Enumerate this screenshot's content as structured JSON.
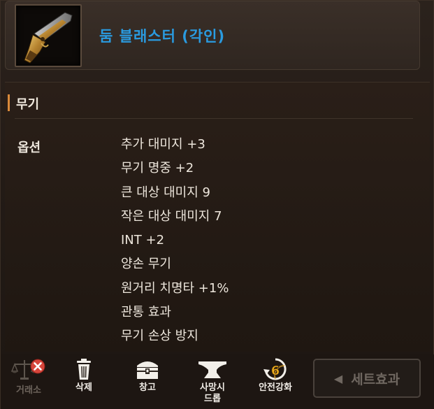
{
  "item": {
    "name": "둠 블래스터 (각인)",
    "icon": "blaster-pistol-icon"
  },
  "section": {
    "title": "무기"
  },
  "options": {
    "label": "옵션",
    "rows": [
      "추가 대미지 +3",
      "무기 명중 +2",
      "큰 대상 대미지 9",
      "작은 대상 대미지 7",
      "INT +2",
      "양손 무기",
      "원거리 치명타 +1%",
      "관통 효과",
      "무기 손상 방지"
    ]
  },
  "actions": {
    "trade": {
      "label": "거래소",
      "icon": "scale-icon",
      "disabled": true
    },
    "delete": {
      "label": "삭제",
      "icon": "trash-icon"
    },
    "storage": {
      "label": "창고",
      "icon": "chest-icon"
    },
    "forge": {
      "label": "사망시 드롭",
      "line1": "사망시",
      "line2": "드롭",
      "icon": "anvil-icon"
    },
    "enchant": {
      "label": "안전강화",
      "icon": "enchant-6-icon",
      "badge": "6"
    },
    "set_effect": {
      "label": "세트효과",
      "icon": "left-arrow-icon"
    }
  },
  "colors": {
    "item_name": "#2a9be0",
    "section_accent": "#d98a3a",
    "disabled_x": "#d6453b"
  }
}
